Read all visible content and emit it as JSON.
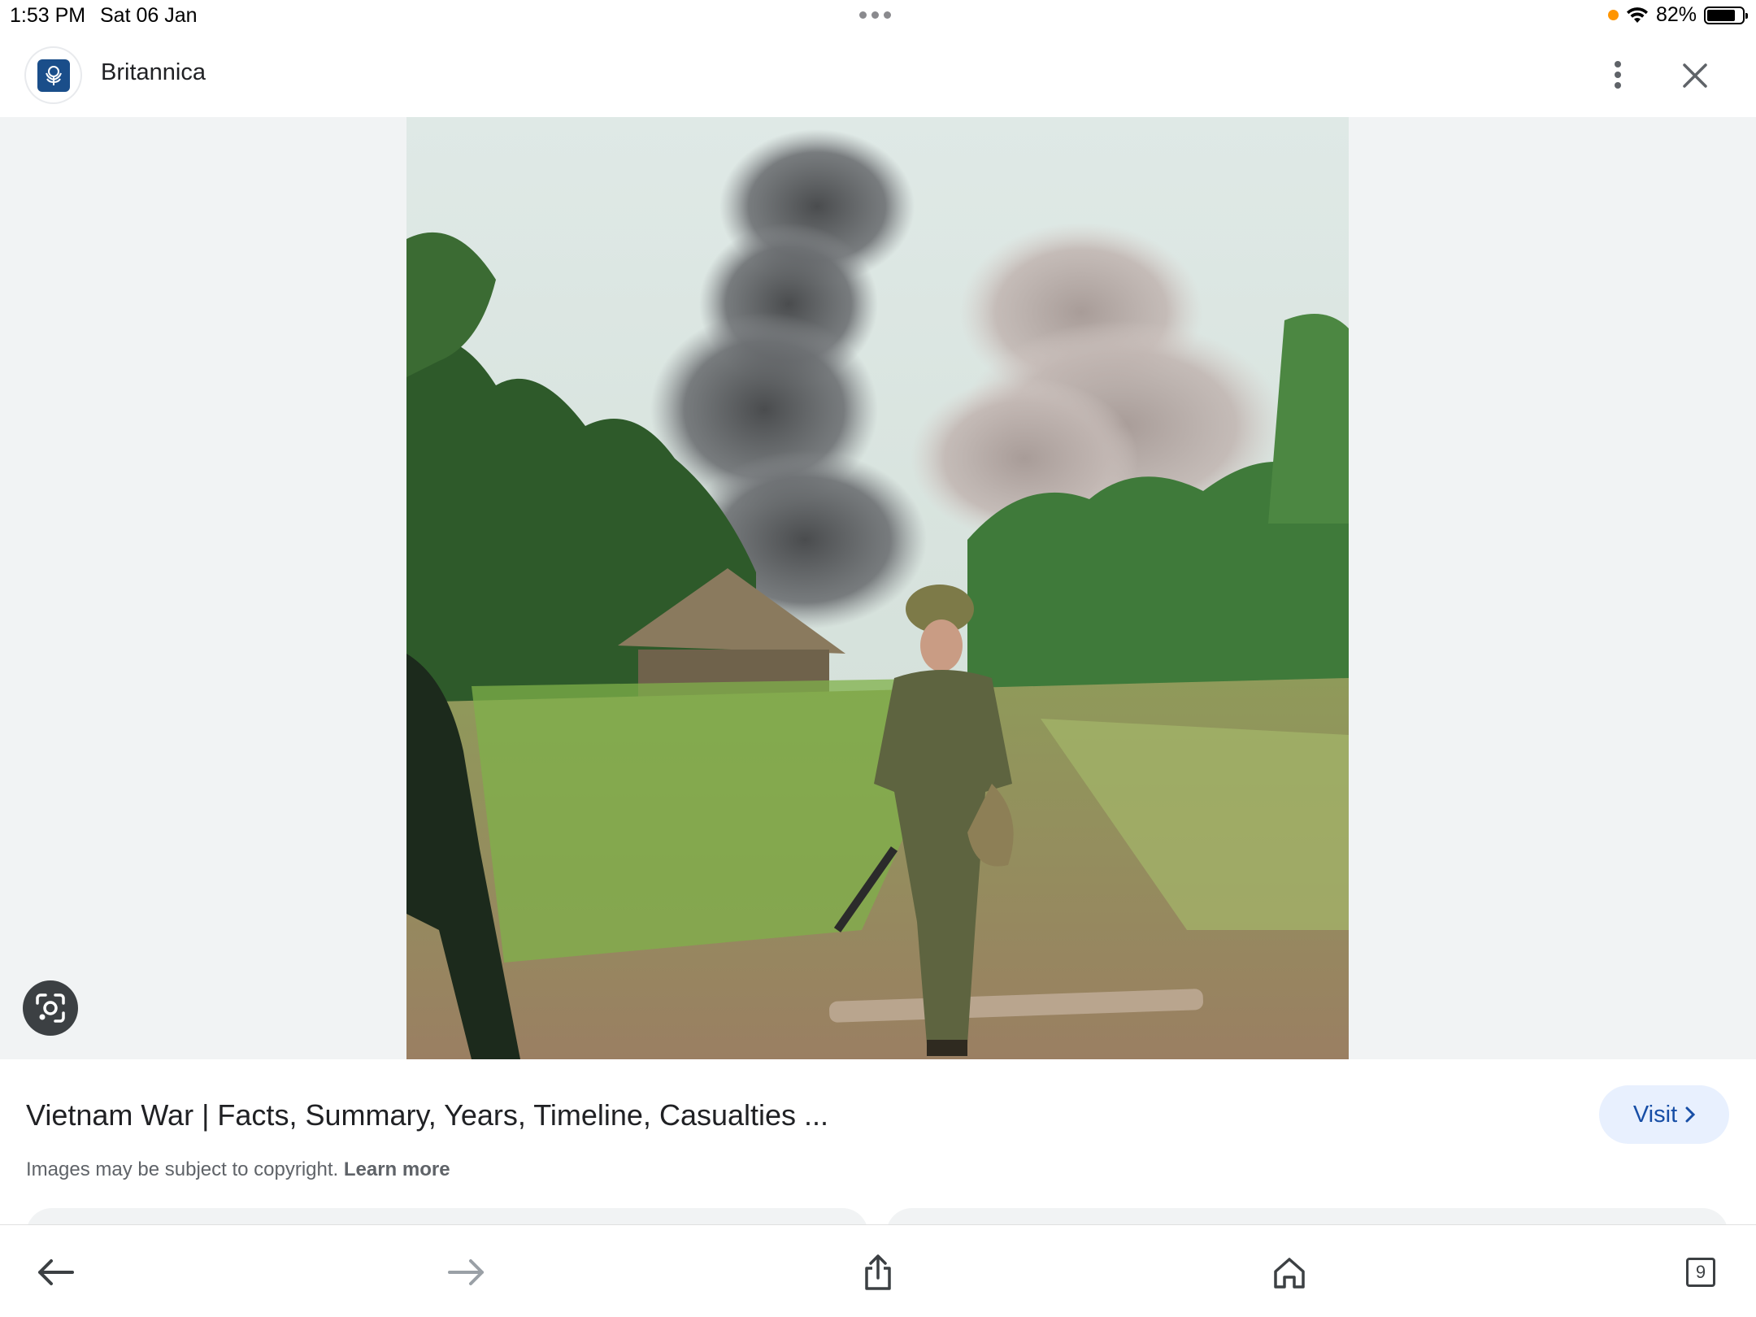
{
  "status_bar": {
    "time": "1:53 PM",
    "date": "Sat 06 Jan",
    "battery": "82%",
    "battery_level": 0.82
  },
  "header": {
    "site_name": "Britannica",
    "logo_icon": "britannica-thistle-logo",
    "more_icon": "more-vertical-icon",
    "close_icon": "close-icon"
  },
  "image_viewer": {
    "lens_icon": "google-lens-icon"
  },
  "result": {
    "title": "Vietnam War | Facts, Summary, Years, Timeline, Casualties ...",
    "visit_label": "Visit",
    "copyright_text": "Images may be subject to copyright.",
    "learn_more": "Learn more"
  },
  "toolbar": {
    "back_icon": "arrow-left-icon",
    "forward_icon": "arrow-right-icon",
    "share_icon": "share-icon",
    "home_icon": "home-icon",
    "tabs_count": "9"
  },
  "colors": {
    "accent": "#174ea6",
    "visit_bg": "#e8f0fe",
    "viewer_bg": "#f1f3f4",
    "logo_blue": "#1a4e8a",
    "recording_dot": "#ff9500"
  }
}
